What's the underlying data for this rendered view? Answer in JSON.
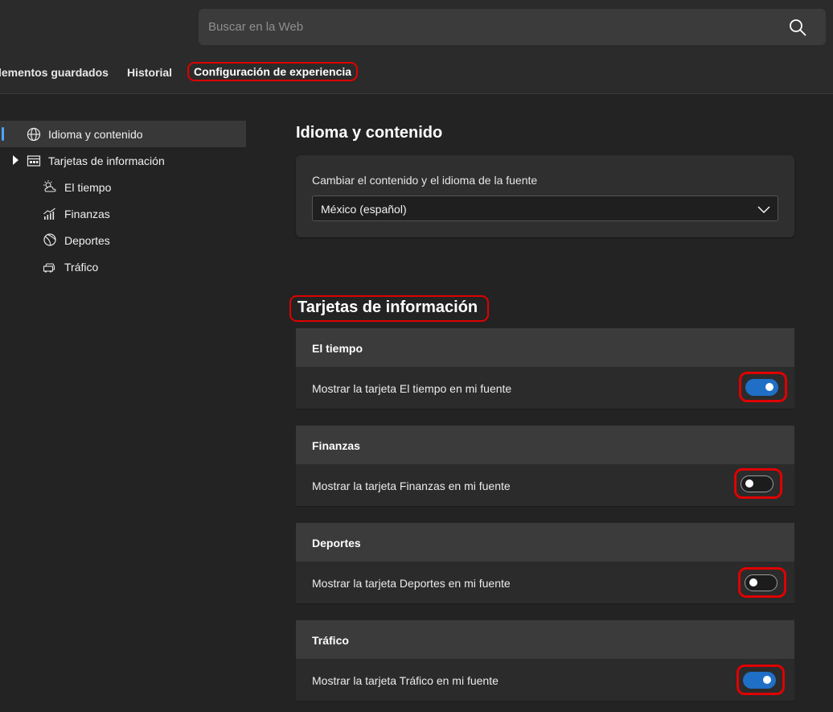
{
  "search": {
    "placeholder": "Buscar en la Web"
  },
  "nav": {
    "tabs": [
      {
        "label": "lementos guardados"
      },
      {
        "label": "Historial"
      },
      {
        "label": "Configuración de experiencia"
      }
    ]
  },
  "sidebar": {
    "items": [
      {
        "label": "Idioma y contenido",
        "icon": "globe-icon"
      },
      {
        "label": "Tarjetas de información",
        "icon": "cards-icon"
      },
      {
        "label": "El tiempo",
        "icon": "weather-icon"
      },
      {
        "label": "Finanzas",
        "icon": "finance-icon"
      },
      {
        "label": "Deportes",
        "icon": "sports-icon"
      },
      {
        "label": "Tráfico",
        "icon": "traffic-icon"
      }
    ]
  },
  "main": {
    "language_title": "Idioma y contenido",
    "language_card": {
      "label": "Cambiar el contenido y el idioma de la fuente",
      "selected": "México (español)"
    },
    "cards_title": "Tarjetas de información",
    "cards": [
      {
        "title": "El tiempo",
        "text": "Mostrar la tarjeta El tiempo en mi fuente",
        "enabled": true
      },
      {
        "title": "Finanzas",
        "text": "Mostrar la tarjeta Finanzas en mi fuente",
        "enabled": false
      },
      {
        "title": "Deportes",
        "text": "Mostrar la tarjeta Deportes en mi fuente",
        "enabled": false
      },
      {
        "title": "Tráfico",
        "text": "Mostrar la tarjeta Tráfico en mi fuente",
        "enabled": true
      }
    ]
  },
  "colors": {
    "accent": "#1f6fc6",
    "highlight": "#e00000",
    "background": "#232323"
  }
}
